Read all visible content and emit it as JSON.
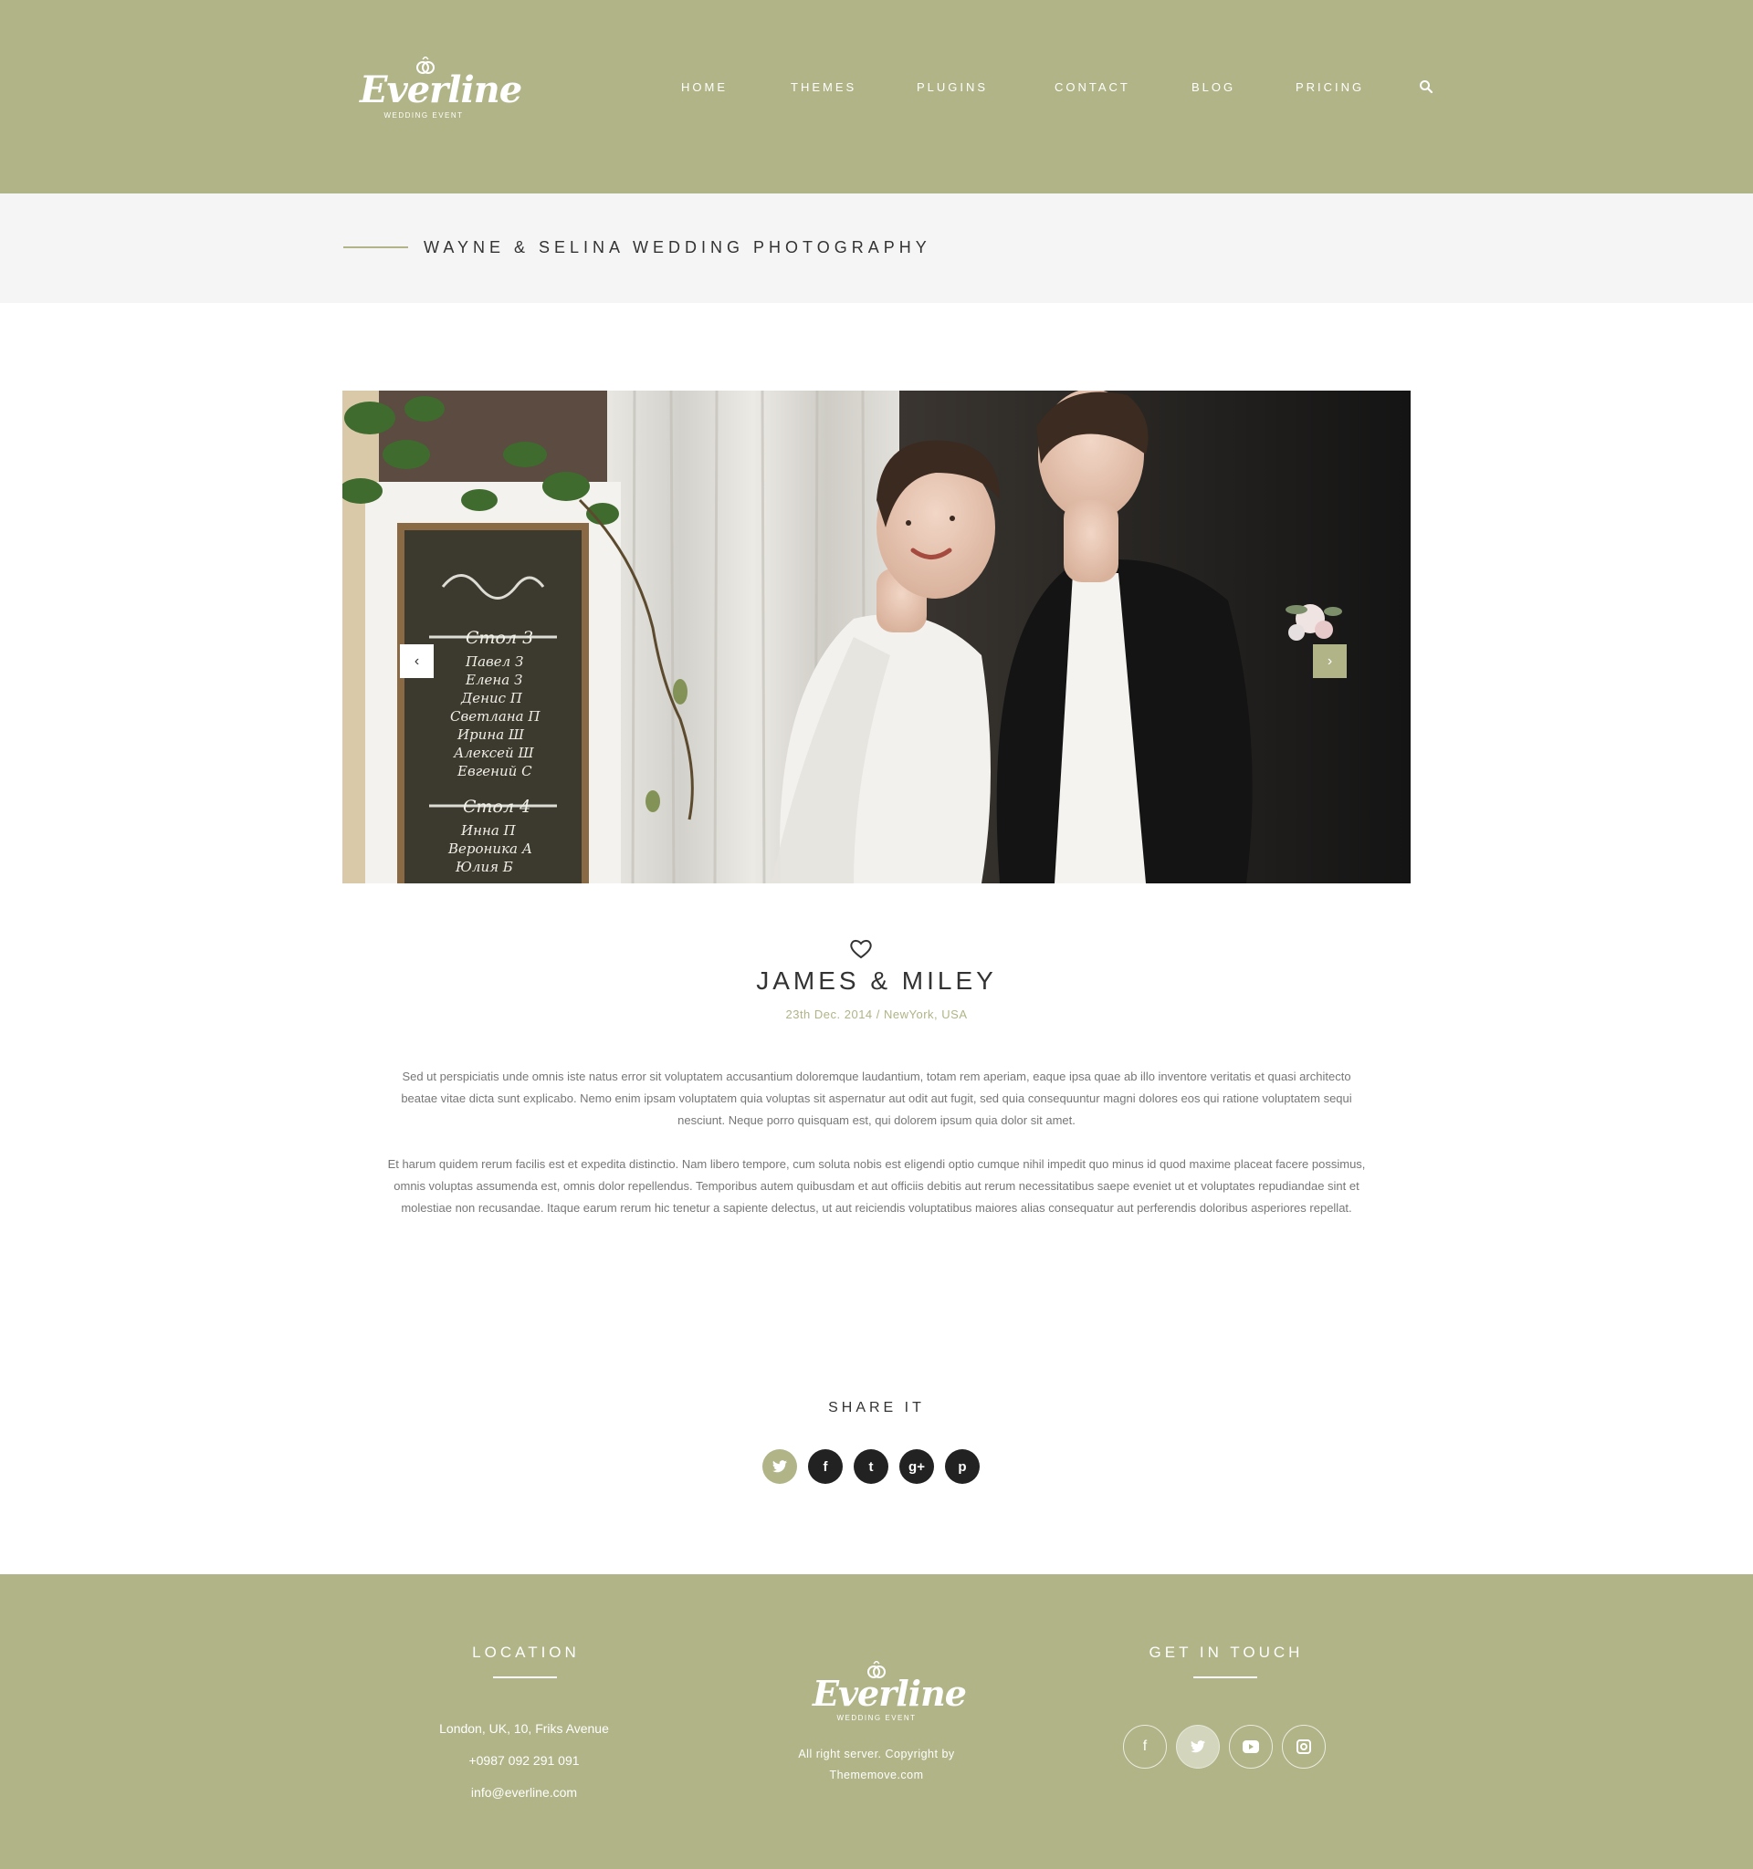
{
  "brand": {
    "name": "Everline",
    "tagline": "WEDDING EVENT"
  },
  "nav": {
    "items": [
      "HOME",
      "THEMES",
      "PLUGINS",
      "CONTACT",
      "BLOG",
      "PRICING"
    ],
    "search_icon": "search-icon"
  },
  "page": {
    "title": "WAYNE & SELINA WEDDING PHOTOGRAPHY"
  },
  "slider": {
    "prev_label": "‹",
    "next_label": "›"
  },
  "post": {
    "icon": "heart-icon",
    "title": "JAMES & MILEY",
    "meta": "23th Dec. 2014 / NewYork, USA",
    "paragraphs": [
      "Sed ut perspiciatis unde omnis iste natus error sit voluptatem accusantium doloremque laudantium, totam rem aperiam, eaque ipsa quae ab illo inventore veritatis et quasi architecto beatae vitae dicta sunt explicabo. Nemo enim ipsam voluptatem quia voluptas sit aspernatur aut odit aut fugit, sed quia consequuntur magni dolores eos qui ratione voluptatem sequi nesciunt. Neque porro quisquam est, qui dolorem ipsum quia dolor sit amet.",
      "Et harum quidem rerum facilis est et expedita distinctio. Nam libero tempore, cum soluta nobis est eligendi optio cumque nihil impedit quo minus id quod maxime placeat facere possimus, omnis voluptas assumenda est, omnis dolor repellendus. Temporibus autem quibusdam et aut officiis debitis aut rerum necessitatibus saepe eveniet ut et voluptates repudiandae sint et molestiae non recusandae. Itaque earum rerum hic tenetur a sapiente delectus, ut aut reiciendis voluptatibus maiores alias consequatur aut perferendis doloribus asperiores repellat."
    ]
  },
  "share": {
    "title": "SHARE IT",
    "icons": [
      "twitter-icon",
      "facebook-icon",
      "tumblr-icon",
      "google-plus-icon",
      "pinterest-icon"
    ],
    "glyphs": [
      "🐦",
      "f",
      "t",
      "g+",
      "p"
    ]
  },
  "footer": {
    "location": {
      "heading": "LOCATION",
      "address": "London, UK, 10, Friks Avenue",
      "phone": "+0987 092 291 091",
      "email": "info@everline.com"
    },
    "center": {
      "copyright_line1": "All right server. Copyright by",
      "copyright_line2": "Thememove.com"
    },
    "contact": {
      "heading": "GET IN TOUCH",
      "icons": [
        "facebook-icon",
        "twitter-icon",
        "youtube-icon",
        "instagram-icon"
      ],
      "glyphs": [
        "f",
        "🐦",
        "▶",
        "◻"
      ]
    }
  },
  "colors": {
    "accent": "#b0b486",
    "title_bar": "#f5f5f5",
    "dark": "#222222"
  }
}
